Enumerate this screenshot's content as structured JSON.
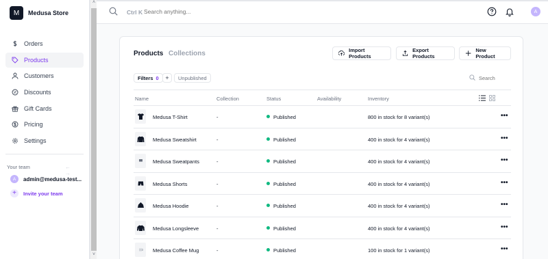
{
  "store": {
    "initial": "M",
    "name": "Medusa Store"
  },
  "nav": [
    {
      "label": "Orders",
      "icon": "dollar-icon",
      "active": false
    },
    {
      "label": "Products",
      "icon": "tag-icon",
      "active": true
    },
    {
      "label": "Customers",
      "icon": "users-icon",
      "active": false
    },
    {
      "label": "Discounts",
      "icon": "discount-icon",
      "active": false
    },
    {
      "label": "Gift Cards",
      "icon": "gift-icon",
      "active": false
    },
    {
      "label": "Pricing",
      "icon": "pricing-icon",
      "active": false
    },
    {
      "label": "Settings",
      "icon": "gear-icon",
      "active": false
    }
  ],
  "team": {
    "label": "Your team",
    "arrows": "← →",
    "user_initial": "A",
    "user_name": "admin@medusa-test...",
    "invite_label": "Invite your team",
    "invite_icon": "+"
  },
  "topbar": {
    "shortcut": "Ctrl K",
    "search_placeholder": "Search anything...",
    "avatar_initial": "A"
  },
  "tabs": {
    "products": "Products",
    "collections": "Collections"
  },
  "actions": {
    "import": "Import Products",
    "export": "Export Products",
    "new": "New Product"
  },
  "filters": {
    "label": "Filters",
    "count": "0",
    "add": "+",
    "chip": "Unpublished",
    "search_placeholder": "Search"
  },
  "columns": {
    "name": "Name",
    "collection": "Collection",
    "status": "Status",
    "availability": "Availability",
    "inventory": "Inventory"
  },
  "products": [
    {
      "name": "Medusa T-Shirt",
      "collection": "-",
      "status": "Published",
      "inventory": "800 in stock for 8 variant(s)",
      "thumb": "tshirt-icon"
    },
    {
      "name": "Medusa Sweatshirt",
      "collection": "-",
      "status": "Published",
      "inventory": "400 in stock for 4 variant(s)",
      "thumb": "sweatshirt-icon"
    },
    {
      "name": "Medusa Sweatpants",
      "collection": "-",
      "status": "Published",
      "inventory": "400 in stock for 4 variant(s)",
      "thumb": "sweatpants-icon"
    },
    {
      "name": "Medusa Shorts",
      "collection": "-",
      "status": "Published",
      "inventory": "400 in stock for 4 variant(s)",
      "thumb": "shorts-icon"
    },
    {
      "name": "Medusa Hoodie",
      "collection": "-",
      "status": "Published",
      "inventory": "400 in stock for 4 variant(s)",
      "thumb": "hoodie-icon"
    },
    {
      "name": "Medusa Longsleeve",
      "collection": "-",
      "status": "Published",
      "inventory": "400 in stock for 4 variant(s)",
      "thumb": "longsleeve-icon"
    },
    {
      "name": "Medusa Coffee Mug",
      "collection": "-",
      "status": "Published",
      "inventory": "100 in stock for 1 variant(s)",
      "thumb": "mug-icon"
    }
  ],
  "row_menu": "•••",
  "colors": {
    "accent": "#7c3aed",
    "published": "#10b981"
  }
}
